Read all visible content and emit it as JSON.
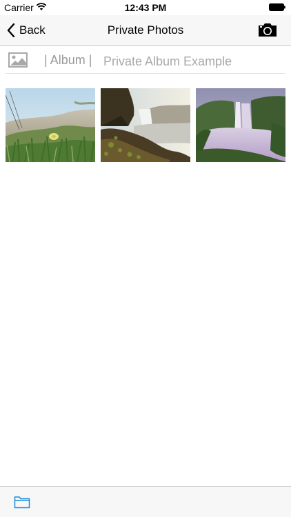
{
  "status_bar": {
    "carrier": "Carrier",
    "time": "12:43 PM"
  },
  "nav": {
    "back_label": "Back",
    "title": "Private Photos",
    "camera_icon": "camera-icon",
    "back_icon": "chevron-left-icon"
  },
  "album": {
    "icon": "image-icon",
    "tag": "| Album |",
    "name": "Private Album Example"
  },
  "photos": [
    {
      "icon": "photo-dunes-flowers"
    },
    {
      "icon": "photo-waterfall-rocks"
    },
    {
      "icon": "photo-waterfall-mist"
    }
  ],
  "toolbar": {
    "folder_icon": "folder-icon"
  },
  "colors": {
    "accent": "#1a8bd8",
    "nav_background": "#f7f7f7",
    "muted_text": "#9a9a9a"
  }
}
